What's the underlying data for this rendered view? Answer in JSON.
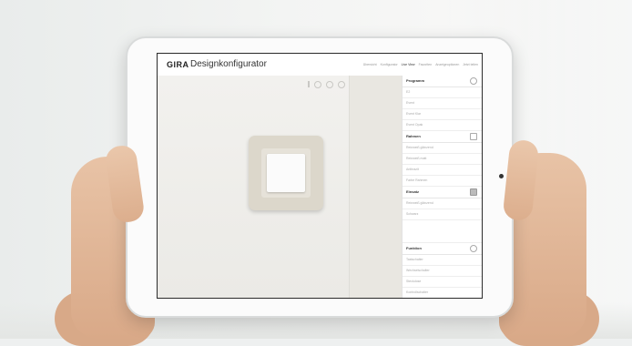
{
  "app": {
    "brand": "GIRA",
    "title": "Designkonfigurator"
  },
  "nav": {
    "items": [
      "Übersicht",
      "Konfigurator",
      "Live View",
      "Favoriten",
      "Anzeigeoptionen",
      "Jetzt teilen"
    ],
    "active_index": 2
  },
  "sidebar": {
    "sections": [
      {
        "title": "Programm",
        "icon": "info-icon",
        "items": [
          "E2",
          "Event",
          "Event Klar",
          "Event Opak"
        ]
      },
      {
        "title": "Rahmen",
        "icon": "checkbox-icon",
        "items": [
          "Reinweiß glänzend",
          "Reinweiß matt",
          "Anthrazit",
          "Farbe Rahmen"
        ]
      },
      {
        "title": "Einsatz",
        "icon": "image-icon",
        "items": [
          "Reinweiß glänzend",
          "Schwarz"
        ]
      },
      {
        "title": "Funktion",
        "icon": "info-icon",
        "items": [
          "Tastschalter",
          "Wechselschalter",
          "Steckdose",
          "Kontrollschalter"
        ]
      }
    ]
  },
  "canvas": {
    "tools": [
      "pin-icon",
      "share-icon",
      "eye-icon",
      "pen-icon"
    ]
  },
  "colors": {
    "frame": "#dcd7cb",
    "rocker": "#fbfbfb",
    "canvas_bg": "#f2f1ee"
  }
}
